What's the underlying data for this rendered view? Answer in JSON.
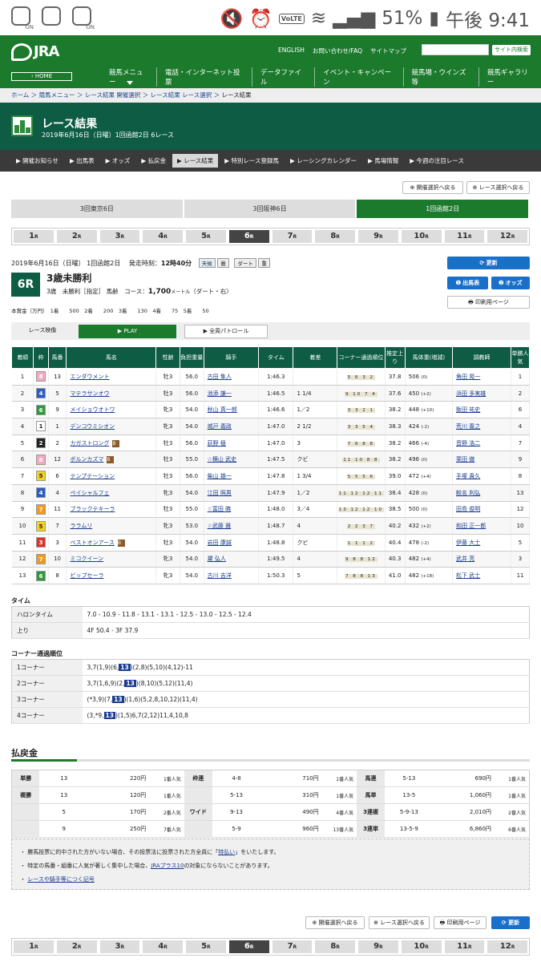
{
  "status": {
    "battery": "51%",
    "time": "午後 9:41",
    "lte": "VoLTE",
    "icon_labels": [
      "ON",
      "ON"
    ]
  },
  "header": {
    "logo": "JRA",
    "home": "‹ HOME",
    "links": [
      "ENGLISH",
      "お問い合わせ/FAQ",
      "サイトマップ"
    ],
    "search_btn": "サイト内検索",
    "nav": [
      "競馬メニュー",
      "電話・インターネット投票",
      "データファイル",
      "イベント・キャンペーン",
      "競馬場・ウインズ等",
      "競馬ギャラリー"
    ]
  },
  "crumb": [
    "ホーム",
    "競馬メニュー",
    "レース結果 開催選択",
    "レース結果 レース選択",
    "レース結果"
  ],
  "title": {
    "main": "レース結果",
    "sub": "2019年6月16日（日曜）1回函館2日 6レース"
  },
  "subnav": [
    "開催お知らせ",
    "出馬表",
    "オッズ",
    "払戻金",
    "レース結果",
    "特別レース登録馬",
    "レーシングカレンダー",
    "馬場情報",
    "今週の注目レース"
  ],
  "buttons": {
    "back_meet": "開催選択へ戻る",
    "back_race": "レース選択へ戻る",
    "update": "更新",
    "entries": "出馬表",
    "odds": "オッズ",
    "print": "印刷用ページ"
  },
  "tracks": [
    "3回東京6日",
    "3回阪神6日",
    "1回函館2日"
  ],
  "races": [
    "1",
    "2",
    "3",
    "4",
    "5",
    "6",
    "7",
    "8",
    "9",
    "10",
    "11",
    "12"
  ],
  "race_suffix": "R",
  "race": {
    "date": "2019年6月16日（日曜） 1回函館2日",
    "start_label": "発走時刻：",
    "start": "12時40分",
    "weather": "天候",
    "weather_val": "曇",
    "ground": "ダート",
    "ground_val": "重",
    "num": "6R",
    "name": "3歳未勝利",
    "cond": "3歳　未勝利［指定］ 馬齢",
    "course_label": "コース：",
    "course": "1,700",
    "course_unit": "メートル",
    "course_note": "（ダート・右）",
    "prize": "本賞金（万円）　1着　　500　2着　　200　3着　　130　4着　　75　5着　　50"
  },
  "video": {
    "label": "レース映像",
    "play": "PLAY",
    "patrol": "全周パトロール"
  },
  "table": {
    "headers": [
      "着順",
      "枠",
      "馬番",
      "馬名",
      "性齢",
      "負担重量",
      "騎手",
      "タイム",
      "着差",
      "コーナー通過順位",
      "推定上り",
      "馬体重(増減)",
      "調教師",
      "単勝人気"
    ],
    "rows": [
      [
        "1",
        "8",
        "13",
        "エンダウメント",
        "牡3",
        "56.0",
        "古田 隼人",
        "1:46.3",
        "",
        "5 6 3 2",
        "37.8",
        "506",
        "(0)",
        "角田 晃一",
        "1",
        ""
      ],
      [
        "2",
        "4",
        "5",
        "マテラサンオウ",
        "牡3",
        "56.0",
        "池添 謙一",
        "1:46.5",
        "1 1/4",
        "9 10 7 4",
        "37.6",
        "450",
        "(+2)",
        "浜田 多実雄",
        "2",
        ""
      ],
      [
        "3",
        "6",
        "9",
        "メイショウオトワ",
        "牝3",
        "54.0",
        "秋山 真一郎",
        "1:46.6",
        "1／2",
        "3 3 2 1",
        "38.2",
        "448",
        "(+10)",
        "飯田 祐史",
        "6",
        ""
      ],
      [
        "4",
        "1",
        "1",
        "デンコウミシオン",
        "牝3",
        "54.0",
        "城戸 義政",
        "1:47.0",
        "2 1/2",
        "3 3 5 4",
        "38.3",
        "424",
        "(-2)",
        "荒川 義之",
        "4",
        ""
      ],
      [
        "5",
        "2",
        "2",
        "カガストロング",
        "牡3",
        "56.0",
        "荻野 極",
        "1:47.0",
        "3",
        "7 6 8 8",
        "38.2",
        "466",
        "(-4)",
        "音野 浩二",
        "7",
        "B"
      ],
      [
        "6",
        "8",
        "12",
        "ボルンカズマ",
        "牡3",
        "55.0",
        "☆横山 武史",
        "1:47.5",
        "クビ",
        "11 10 8 8",
        "38.2",
        "496",
        "(0)",
        "栗田 徹",
        "9",
        "B"
      ],
      [
        "7",
        "5",
        "6",
        "テンプテーション",
        "牡3",
        "56.0",
        "柴山 雄一",
        "1:47.8",
        "1 3/4",
        "5 5 5 6",
        "39.0",
        "472",
        "(+4)",
        "手塚 貴久",
        "8",
        ""
      ],
      [
        "8",
        "4",
        "4",
        "ペイシャルフェ",
        "牝3",
        "54.0",
        "江田 照男",
        "1:47.9",
        "1／2",
        "11 12 12 11",
        "38.4",
        "428",
        "(0)",
        "鮫名 利弘",
        "13",
        ""
      ],
      [
        "9",
        "7",
        "11",
        "ブラックテキーラ",
        "牡3",
        "55.0",
        "☆富田 暁",
        "1:48.0",
        "3／4",
        "13 12 12 10",
        "38.5",
        "500",
        "(0)",
        "田島 俊明",
        "12",
        ""
      ],
      [
        "10",
        "5",
        "7",
        "ララムリ",
        "牝3",
        "53.0",
        "☆武藤 雅",
        "1:48.7",
        "4",
        "2 2 3 7",
        "40.2",
        "432",
        "(+2)",
        "和田 正一郎",
        "10",
        ""
      ],
      [
        "11",
        "3",
        "3",
        "ベストオンアース",
        "牡3",
        "54.0",
        "岩田 康誠",
        "1:48.8",
        "クビ",
        "1 1 1 2",
        "40.4",
        "478",
        "(-2)",
        "伊藤 大士",
        "5",
        "B"
      ],
      [
        "12",
        "7",
        "10",
        "ミコクイーン",
        "牝3",
        "54.0",
        "黛 弘人",
        "1:49.5",
        "4",
        "9 8 8 12",
        "40.3",
        "482",
        "(+4)",
        "武井 亮",
        "3",
        ""
      ],
      [
        "13",
        "6",
        "8",
        "ビップセーラ",
        "牝3",
        "54.0",
        "古川 吉洋",
        "1:50.3",
        "5",
        "7 8 8 13",
        "41.0",
        "482",
        "(+18)",
        "松下 武士",
        "11",
        ""
      ]
    ]
  },
  "time": {
    "heading": "タイム",
    "rows": [
      [
        "ハロンタイム",
        "7.0 - 10.9 - 11.8 - 13.1 - 13.1 - 12.5 - 13.0 - 12.5 - 12.4"
      ],
      [
        "上り",
        "4F 50.4 - 3F 37.9"
      ]
    ]
  },
  "corners": {
    "heading": "コーナー通過順位",
    "rows": [
      [
        "1コーナー",
        "3,7(1,9)(6,",
        "13",
        ")(2,8)(5,10)(4,12)-11"
      ],
      [
        "2コーナー",
        "3,7(1,6,9)(2,",
        "13",
        ")(8,10)(5,12)(11,4)"
      ],
      [
        "3コーナー",
        "(*3,9)(7,",
        "13",
        ")(1,6)(5,2,8,10,12)(11,4)"
      ],
      [
        "4コーナー",
        "(3,*9,",
        "13",
        ")(1,5)6,7(2,12)11,4,10,8"
      ]
    ]
  },
  "payout": {
    "heading": "払戻金",
    "rows": [
      [
        "単勝",
        "13",
        "220円",
        "1番人気",
        "枠連",
        "4-8",
        "710円",
        "1番人気",
        "馬連",
        "5-13",
        "690円",
        "1番人気"
      ],
      [
        "複勝",
        "13",
        "120円",
        "1番人気",
        "",
        "5-13",
        "310円",
        "1番人気",
        "馬単",
        "13-5",
        "1,060円",
        "1番人気"
      ],
      [
        "",
        "5",
        "170円",
        "2番人気",
        "ワイド",
        "9-13",
        "490円",
        "4番人気",
        "3連複",
        "5-9-13",
        "2,010円",
        "2番人気"
      ],
      [
        "",
        "9",
        "250円",
        "7番人気",
        "",
        "5-9",
        "960円",
        "13番人気",
        "3連単",
        "13-5-9",
        "6,860円",
        "6番人気"
      ]
    ]
  },
  "notes": [
    "勝馬投票に的中された方がいない場合、その投票法に投票された方全員に「",
    "特払い",
    "」をいたします。",
    "特定の馬番・組番に人気が著しく集中した場合、",
    "JRAプラス10",
    "の対象にならないことがあります。",
    "レースや騎手等につく記号"
  ],
  "colors": {
    "green": "#1b7a2c",
    "dark_green": "#0d5c43",
    "blue": "#1a6fc9",
    "waku": [
      "#ffffff",
      "#ffffff",
      "#222222",
      "#d9342b",
      "#2a5cc4",
      "#f2d21b",
      "#2e9a3c",
      "#f39a1a",
      "#f4a7c0"
    ]
  }
}
